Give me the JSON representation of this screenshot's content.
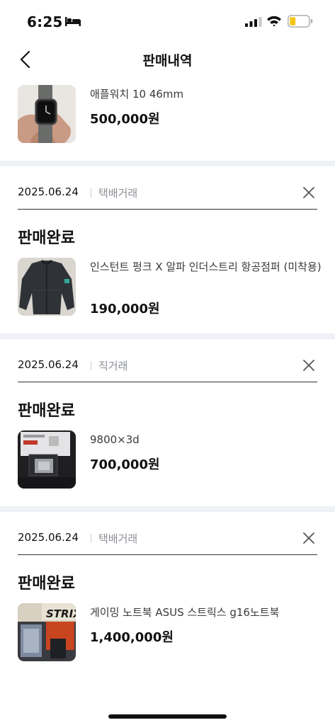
{
  "status_bar": {
    "time": "6:25",
    "icons": [
      "bed-icon",
      "signal-icon",
      "wifi-icon",
      "battery-icon"
    ],
    "battery_color": "#f5c518"
  },
  "nav": {
    "title": "판매내역",
    "back_icon": "chevron-left-icon"
  },
  "top_item": {
    "name": "애플워치 10 46mm",
    "price": "500,000원"
  },
  "cards": [
    {
      "date": "2025.06.24",
      "trade_type": "택배거래",
      "status": "판매완료",
      "name": "인스턴트 펑크 X 알파 인더스트리 항공점퍼 (미착용)",
      "price": "190,000원"
    },
    {
      "date": "2025.06.24",
      "trade_type": "직거래",
      "status": "판매완료",
      "name": "9800×3d",
      "price": "700,000원"
    },
    {
      "date": "2025.06.24",
      "trade_type": "택배거래",
      "status": "판매완료",
      "name": "게이밍 노트북 ASUS 스트릭스 g16노트북",
      "price": "1,400,000원",
      "thumb_text": "STRIX"
    }
  ],
  "colors": {
    "divider_band": "#eef1f5",
    "secondary_text": "#8b8f96"
  }
}
